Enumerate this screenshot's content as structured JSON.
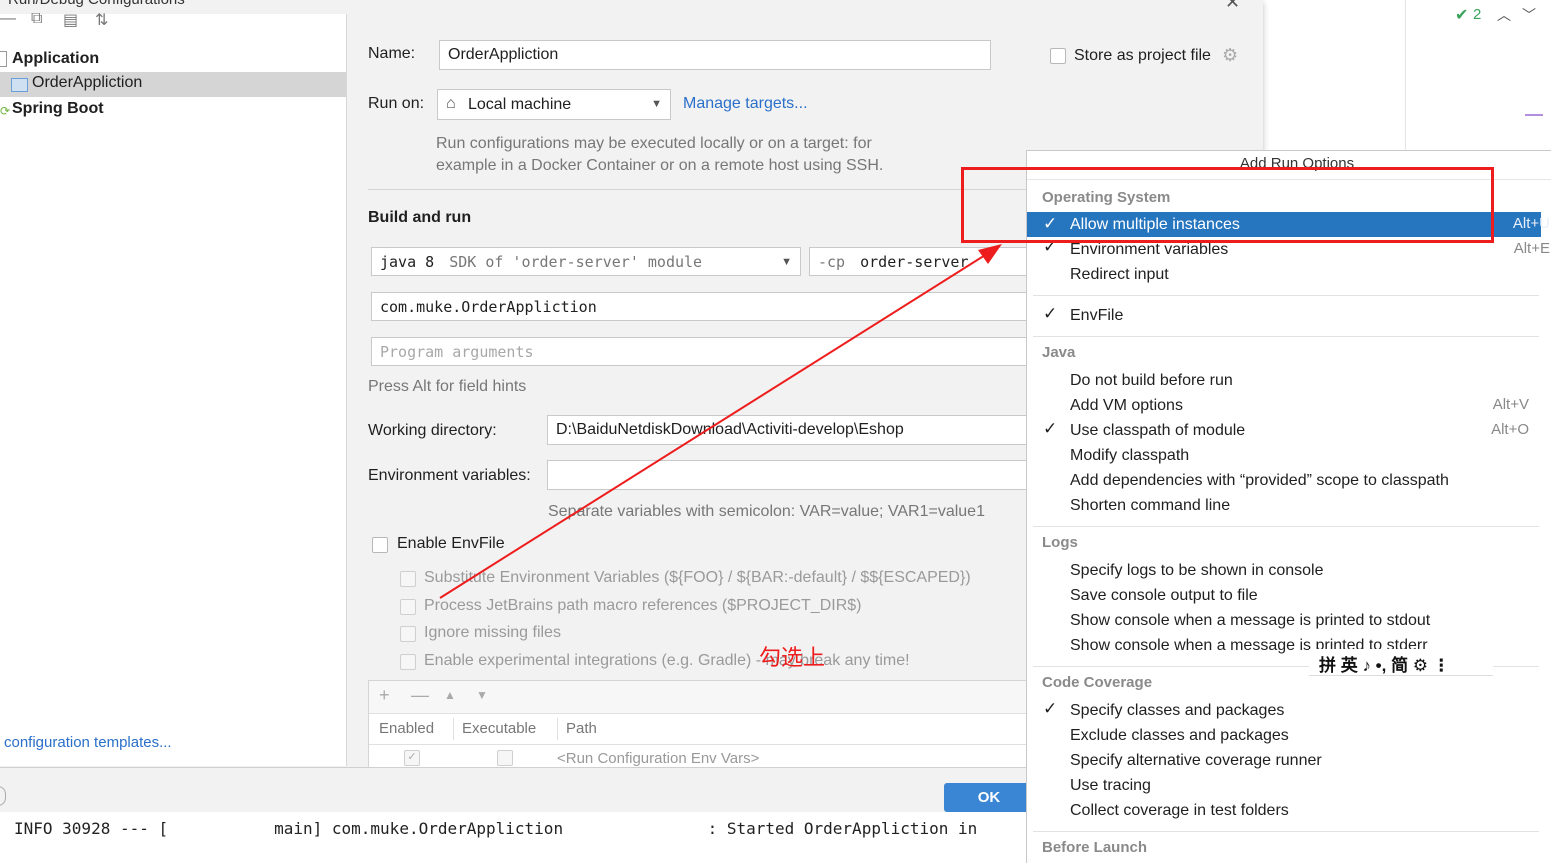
{
  "window_title": "Run/Debug Configurations",
  "ide_indicator": "2",
  "tree": {
    "items": [
      {
        "label": "Application"
      },
      {
        "label": "OrderAppliction"
      },
      {
        "label": "Spring Boot"
      }
    ],
    "templates_link": "configuration templates..."
  },
  "form": {
    "name_label": "Name:",
    "name_value": "OrderAppliction",
    "store_label": "Store as project file",
    "run_on_label": "Run on:",
    "run_on_value": "Local machine",
    "manage_targets": "Manage targets...",
    "run_on_hint_1": "Run configurations may be executed locally or on a target: for",
    "run_on_hint_2": "example in a Docker Container or on a remote host using SSH.",
    "build_and_run": "Build and run",
    "jdk_java": "java 8",
    "jdk_detail": "SDK of 'order-server' module",
    "cp_flag": "-cp",
    "cp_value": "order-server",
    "main_class": "com.muke.OrderAppliction",
    "program_args_placeholder": "Program arguments",
    "field_hints": "Press Alt for field hints",
    "working_dir_label": "Working directory:",
    "working_dir_value": "D:\\BaiduNetdiskDownload\\Activiti-develop\\Eshop",
    "env_vars_label": "Environment variables:",
    "env_vars_hint": "Separate variables with semicolon: VAR=value; VAR1=value1",
    "enable_envfile": "Enable EnvFile",
    "envfile_options": [
      "Substitute Environment Variables (${FOO} / ${BAR:-default} / $${ESCAPED})",
      "Process JetBrains path macro references ($PROJECT_DIR$)",
      "Ignore missing files",
      "Enable experimental integrations (e.g. Gradle) - may break any time!"
    ],
    "table_headers": [
      "Enabled",
      "Executable",
      "Path"
    ],
    "table_row_path": "<Run Configuration Env Vars>",
    "ok_button": "OK"
  },
  "console_line": "INFO 30928 --- [           main] com.muke.OrderAppliction               : Started OrderAppliction in",
  "annotation": "勾选上",
  "ime_bar": "拼 英 ♪ •, 简 ⚙ ⋮",
  "popup": {
    "title": "Add Run Options",
    "sections": [
      {
        "title": "Operating System",
        "items": [
          {
            "label": "Allow multiple instances",
            "checked": true,
            "shortcut": "Alt+U",
            "selected": true
          },
          {
            "label": "Environment variables",
            "checked": true,
            "shortcut": "Alt+E"
          },
          {
            "label": "Redirect input",
            "checked": false,
            "shortcut": ""
          }
        ]
      },
      {
        "title": "",
        "items": [
          {
            "label": "EnvFile",
            "checked": true,
            "shortcut": ""
          }
        ]
      },
      {
        "title": "Java",
        "items": [
          {
            "label": "Do not build before run",
            "checked": false,
            "shortcut": ""
          },
          {
            "label": "Add VM options",
            "checked": false,
            "shortcut": "Alt+V"
          },
          {
            "label": "Use classpath of module",
            "checked": true,
            "shortcut": "Alt+O"
          },
          {
            "label": "Modify classpath",
            "checked": false,
            "shortcut": ""
          },
          {
            "label": "Add dependencies with “provided” scope to classpath",
            "checked": false,
            "shortcut": ""
          },
          {
            "label": "Shorten command line",
            "checked": false,
            "shortcut": ""
          }
        ]
      },
      {
        "title": "Logs",
        "items": [
          {
            "label": "Specify logs to be shown in console",
            "checked": false,
            "shortcut": ""
          },
          {
            "label": "Save console output to file",
            "checked": false,
            "shortcut": ""
          },
          {
            "label": "Show console when a message is printed to stdout",
            "checked": false,
            "shortcut": ""
          },
          {
            "label": "Show console when a message is printed to stderr",
            "checked": false,
            "shortcut": ""
          }
        ]
      },
      {
        "title": "Code Coverage",
        "items": [
          {
            "label": "Specify classes and packages",
            "checked": true,
            "shortcut": ""
          },
          {
            "label": "Exclude classes and packages",
            "checked": false,
            "shortcut": ""
          },
          {
            "label": "Specify alternative coverage runner",
            "checked": false,
            "shortcut": ""
          },
          {
            "label": "Use tracing",
            "checked": false,
            "shortcut": ""
          },
          {
            "label": "Collect coverage in test folders",
            "checked": false,
            "shortcut": ""
          }
        ]
      },
      {
        "title": "Before Launch",
        "items": []
      }
    ]
  },
  "colors": {
    "selection": "#2675bf",
    "annotation_red": "#ee1d1d",
    "link": "#2a6fc9"
  }
}
